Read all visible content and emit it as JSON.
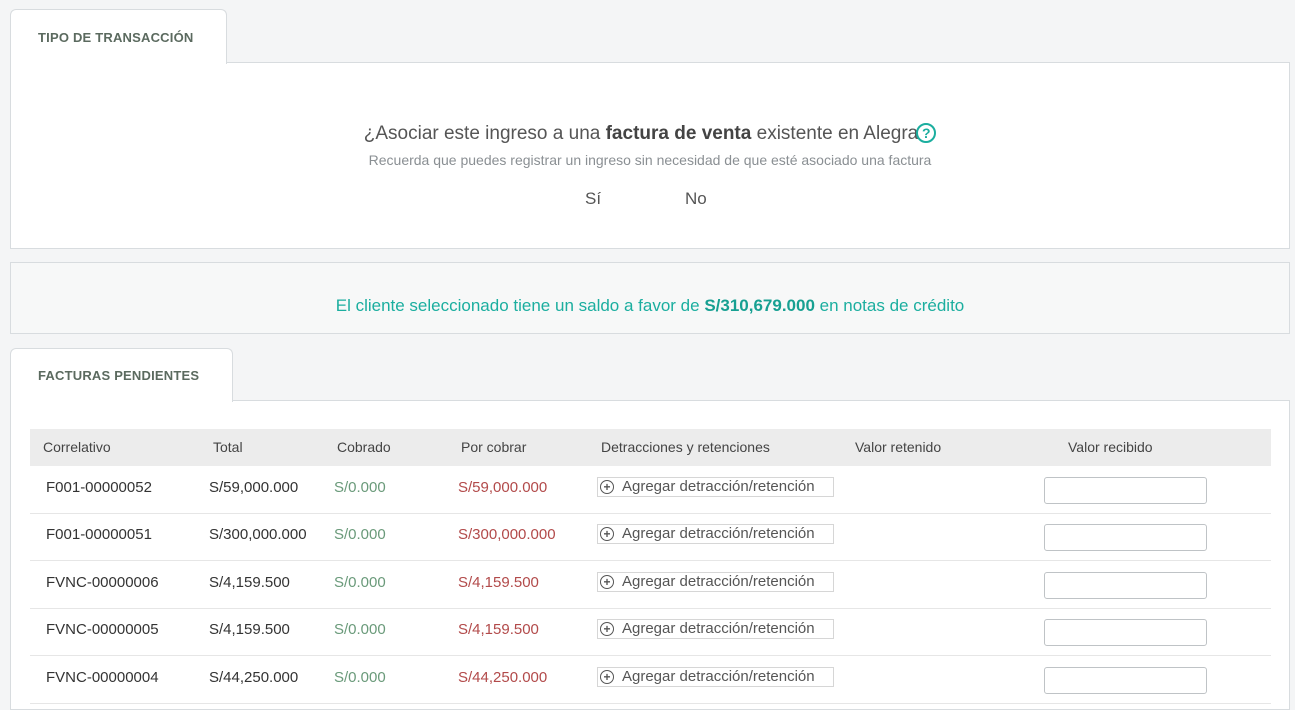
{
  "transaction": {
    "tab_label": "TIPO DE TRANSACCIÓN",
    "question_prefix": "¿Asociar este ingreso a una ",
    "question_bold": "factura de venta",
    "question_suffix": " existente en Alegra",
    "help_icon": "?",
    "hint": "Recuerda que puedes registrar un ingreso sin necesidad de que esté asociado una factura",
    "option_yes": "Sí",
    "option_no": "No"
  },
  "credit_notice": {
    "prefix": "El cliente seleccionado tiene un saldo a favor de ",
    "amount": "S/310,679.000",
    "suffix": " en notas de crédito",
    "color": "#1bae9f"
  },
  "invoices": {
    "tab_label": "FACTURAS PENDIENTES",
    "headers": {
      "correlativo": "Correlativo",
      "total": "Total",
      "cobrado": "Cobrado",
      "por_cobrar": "Por cobrar",
      "detracciones": "Detracciones y retenciones",
      "valor_retenido": "Valor retenido",
      "valor_recibido": "Valor recibido"
    },
    "add_label": "Agregar detracción/retención",
    "add_icon": "plus-circle-icon",
    "rows": [
      {
        "correlativo": "F001-00000052",
        "total": "S/59,000.000",
        "cobrado": "S/0.000",
        "por_cobrar": "S/59,000.000"
      },
      {
        "correlativo": "F001-00000051",
        "total": "S/300,000.000",
        "cobrado": "S/0.000",
        "por_cobrar": "S/300,000.000"
      },
      {
        "correlativo": "FVNC-00000006",
        "total": "S/4,159.500",
        "cobrado": "S/0.000",
        "por_cobrar": "S/4,159.500"
      },
      {
        "correlativo": "FVNC-00000005",
        "total": "S/4,159.500",
        "cobrado": "S/0.000",
        "por_cobrar": "S/4,159.500"
      },
      {
        "correlativo": "FVNC-00000004",
        "total": "S/44,250.000",
        "cobrado": "S/0.000",
        "por_cobrar": "S/44,250.000"
      }
    ]
  }
}
